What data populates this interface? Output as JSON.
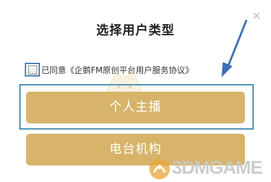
{
  "dialog": {
    "title": "选择用户类型",
    "close_icon": "close-icon",
    "close_glyph": "×"
  },
  "agreement": {
    "checked": false,
    "text": "已同意《企鹅FM原创平台用户服务协议》"
  },
  "buttons": {
    "anchor_label": "个人主播",
    "station_label": "电台机构"
  },
  "watermark": {
    "text": "3DMGAME"
  },
  "colors": {
    "button_fill": "#d7b46a",
    "highlight_border": "#4e92b5",
    "arrow": "#3f6fb5"
  }
}
